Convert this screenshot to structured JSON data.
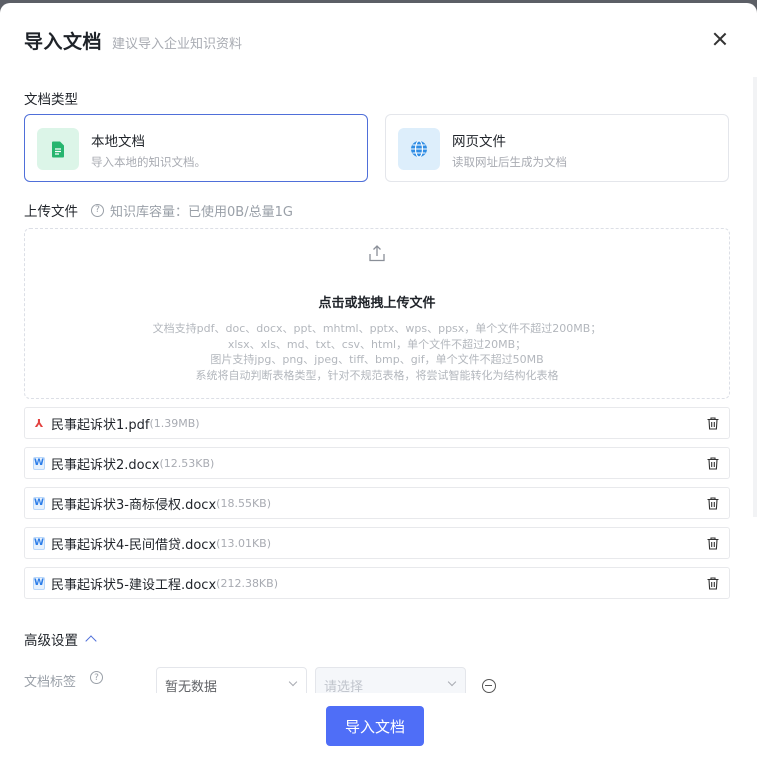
{
  "dialog": {
    "title": "导入文档",
    "subtitle": "建议导入企业知识资料"
  },
  "doc_type": {
    "label": "文档类型",
    "options": [
      {
        "title": "本地文档",
        "desc": "导入本地的知识文档。",
        "selected": true,
        "icon": "document-icon",
        "color": "#27b56f"
      },
      {
        "title": "网页文件",
        "desc": "读取网址后生成为文档",
        "selected": false,
        "icon": "globe-icon",
        "color": "#2f8de4"
      }
    ]
  },
  "upload": {
    "label": "上传文件",
    "capacity": "知识库容量：已使用0B/总量1G",
    "drop_title": "点击或拖拽上传文件",
    "drop_lines": [
      "文档支持pdf、doc、docx、ppt、mhtml、pptx、wps、ppsx，单个文件不超过200MB；",
      "xlsx、xls、md、txt、csv、html，单个文件不超过20MB；",
      "图片支持jpg、png、jpeg、tiff、bmp、gif，单个文件不超过50MB",
      "系统将自动判断表格类型，针对不规范表格，将尝试智能转化为结构化表格"
    ]
  },
  "files": [
    {
      "name": "民事起诉状1.pdf",
      "size": "(1.39MB)",
      "type": "pdf"
    },
    {
      "name": "民事起诉状2.docx",
      "size": "(12.53KB)",
      "type": "word"
    },
    {
      "name": "民事起诉状3-商标侵权.docx",
      "size": "(18.55KB)",
      "type": "word"
    },
    {
      "name": "民事起诉状4-民间借贷.docx",
      "size": "(13.01KB)",
      "type": "word"
    },
    {
      "name": "民事起诉状5-建设工程.docx",
      "size": "(212.38KB)",
      "type": "word"
    }
  ],
  "advanced": {
    "label": "高级设置",
    "tag_label": "文档标签",
    "tag_select": "暂无数据",
    "value_select": "请选择"
  },
  "footer": {
    "submit_label": "导入文档"
  },
  "colors": {
    "primary": "#4f6ef7",
    "selected_border": "#4f6fd9"
  }
}
